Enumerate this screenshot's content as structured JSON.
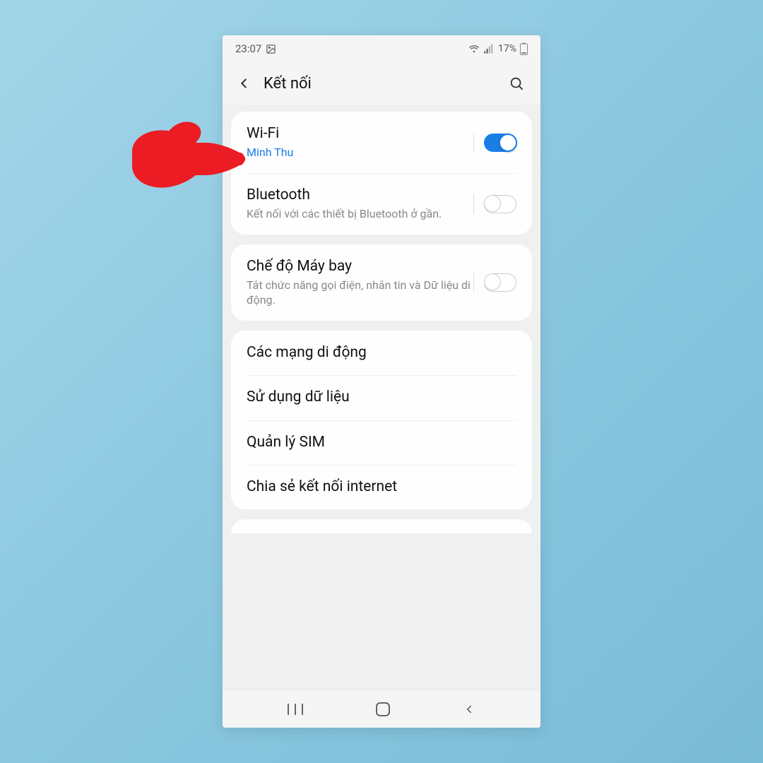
{
  "status": {
    "time": "23:07",
    "battery_pct": "17%"
  },
  "header": {
    "title": "Kết nối"
  },
  "groups": [
    {
      "rows": [
        {
          "title": "Wi-Fi",
          "sub": "Minh Thu",
          "sub_blue": true,
          "toggle": true,
          "on": true
        },
        {
          "title": "Bluetooth",
          "sub": "Kết nối với các thiết bị Bluetooth ở gần.",
          "sub_blue": false,
          "toggle": true,
          "on": false
        }
      ]
    },
    {
      "rows": [
        {
          "title": "Chế độ Máy bay",
          "sub": "Tắt chức năng gọi điện, nhắn tin và Dữ liệu di động.",
          "sub_blue": false,
          "toggle": true,
          "on": false
        }
      ]
    },
    {
      "rows": [
        {
          "title": "Các mạng di động",
          "toggle": false
        },
        {
          "title": "Sử dụng dữ liệu",
          "toggle": false
        },
        {
          "title": "Quản lý SIM",
          "toggle": false
        },
        {
          "title": "Chia sẻ kết nối internet",
          "toggle": false
        }
      ]
    }
  ],
  "colors": {
    "accent": "#1a7ee6",
    "annotation": "#ec1c24"
  }
}
